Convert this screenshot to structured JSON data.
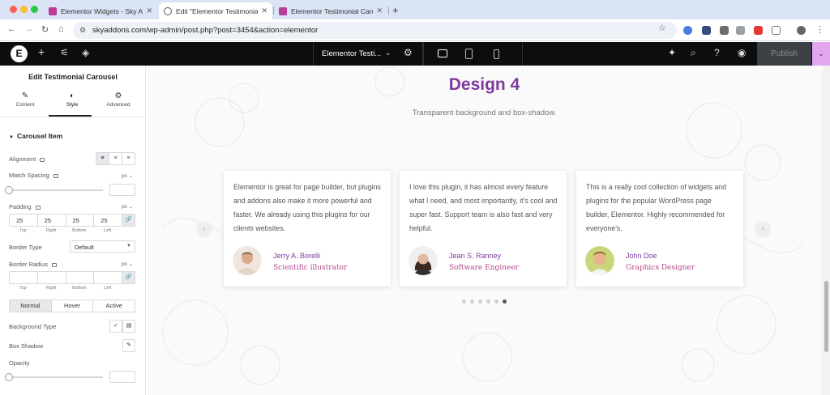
{
  "browser": {
    "tabs": [
      {
        "title": "Elementor Widgets - Sky Addons"
      },
      {
        "title": "Edit \"Elementor Testimonial Carousel\""
      },
      {
        "title": "Elementor Testimonial Carousel"
      }
    ],
    "url": "skyaddons.com/wp-admin/post.php?post=3454&action=elementor"
  },
  "editor": {
    "document_title": "Elementor Testi...",
    "publish_label": "Publish"
  },
  "panel": {
    "title": "Edit Testimonial Carousel",
    "tabs": [
      "Content",
      "Style",
      "Advanced"
    ],
    "section_title": "Carousel Item",
    "alignment_label": "Alignment",
    "match_spacing_label": "Match Spacing",
    "unit_px": "px",
    "padding_label": "Padding",
    "padding_values": [
      "25",
      "25",
      "25",
      "25"
    ],
    "dim_labels": [
      "Top",
      "Right",
      "Bottom",
      "Left"
    ],
    "border_type_label": "Border Type",
    "border_type_value": "Default",
    "border_radius_label": "Border Radius",
    "state_tabs": [
      "Normal",
      "Hover",
      "Active"
    ],
    "background_type_label": "Background Type",
    "box_shadow_label": "Box Shadow",
    "opacity_label": "Opacity"
  },
  "canvas": {
    "title": "Design 4",
    "subtitle": "Transparent background and box-shadow.",
    "testimonials": [
      {
        "quote": "Elementor is great for page builder, but plugins and addons also make it more powerful and faster. We already using this plugins for our clients websites.",
        "name": "Jerry A. Borelli",
        "role": "Scientific illustrator"
      },
      {
        "quote": "I love this plugin, it has almost every feature what I need, and most importantly, it's cool and super fast. Support team is also fast and very helpful.",
        "name": "Jean S. Ranney",
        "role": "Software Engineer"
      },
      {
        "quote": "This is a really cool collection of widgets and plugins for the popular WordPress page builder, Elementor. Highly recommended for everyone's.",
        "name": "John Doe",
        "role": "Graphics Designer"
      }
    ],
    "pagination_count": 6,
    "pagination_active": 6
  },
  "colors": {
    "accent_purple": "#7d3ba0",
    "role_pink": "#b44a8c",
    "publish_dropdown": "#e3a7f0"
  }
}
